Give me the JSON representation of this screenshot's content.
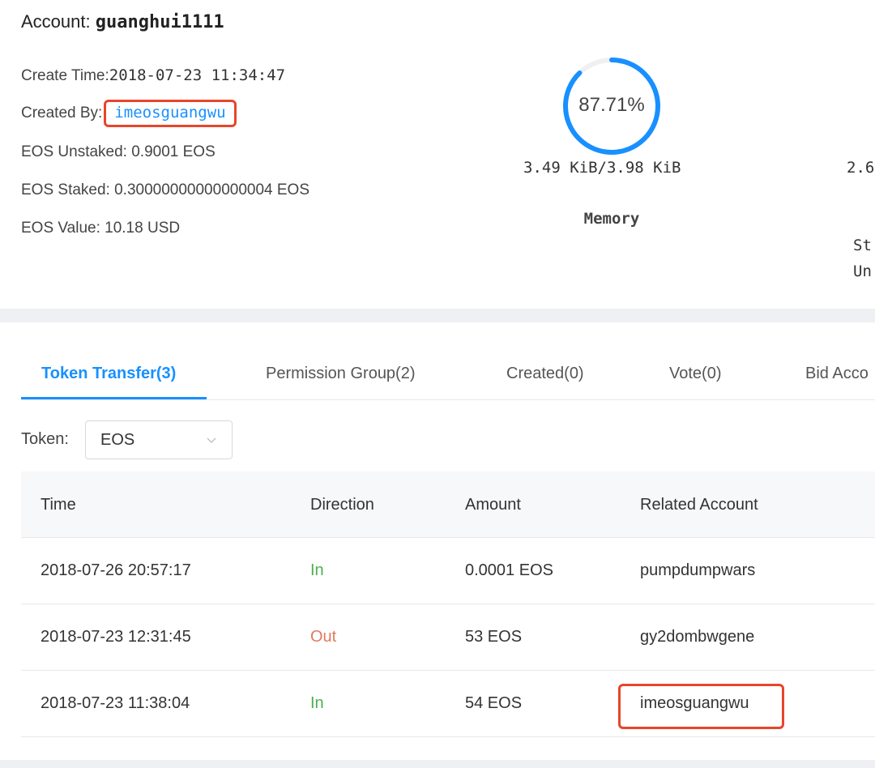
{
  "account": {
    "label": "Account:",
    "name": "guanghui1111",
    "create_time_label": "Create Time:",
    "create_time": "2018-07-23 11:34:47",
    "created_by_label": "Created By:",
    "created_by": "imeosguangwu",
    "eos_unstaked": "EOS Unstaked: 0.9001 EOS",
    "eos_staked": "EOS Staked: 0.30000000000000004 EOS",
    "eos_value": "EOS Value: 10.18 USD"
  },
  "memory": {
    "percent_text": "87.71%",
    "percent": 87.71,
    "usage": "3.49 KiB/3.98 KiB",
    "label": "Memory"
  },
  "cut_off": {
    "value_partial": "2.6",
    "staked_partial": "St",
    "unstaked_partial": "Un"
  },
  "tabs": [
    {
      "label": "Token Transfer(3)",
      "active": true
    },
    {
      "label": "Permission Group(2)"
    },
    {
      "label": "Created(0)"
    },
    {
      "label": "Vote(0)"
    },
    {
      "label": "Bid Acco"
    }
  ],
  "filter": {
    "label": "Token:",
    "value": "EOS"
  },
  "table": {
    "headers": [
      "Time",
      "Direction",
      "Amount",
      "Related Account"
    ],
    "rows": [
      {
        "time": "2018-07-26 20:57:17",
        "direction": "In",
        "amount": "0.0001 EOS",
        "account": "pumpdumpwars"
      },
      {
        "time": "2018-07-23 12:31:45",
        "direction": "Out",
        "amount": "53 EOS",
        "account": "gy2dombwgene"
      },
      {
        "time": "2018-07-23 11:38:04",
        "direction": "In",
        "amount": "54 EOS",
        "account": "imeosguangwu"
      }
    ]
  },
  "colors": {
    "accent": "#1890ff",
    "in": "#4caf50",
    "out": "#e07a5f",
    "highlight": "#e8452a"
  }
}
